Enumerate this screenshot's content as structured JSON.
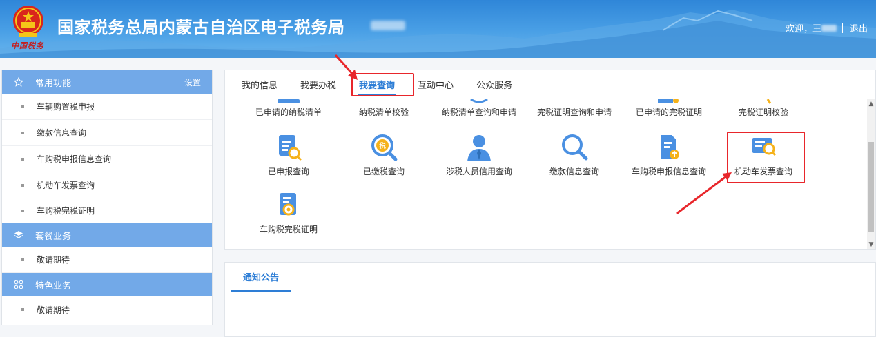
{
  "header": {
    "title": "国家税务总局内蒙古自治区电子税务局",
    "brand_script": "中国税务",
    "welcome": "欢迎，王",
    "logout": "退出"
  },
  "sidebar": {
    "sections": [
      {
        "title": "常用功能",
        "icon": "star-icon",
        "action": "设置",
        "items": [
          "车辆购置税申报",
          "缴款信息查询",
          "车购税申报信息查询",
          "机动车发票查询",
          "车购税完税证明"
        ]
      },
      {
        "title": "套餐业务",
        "icon": "layers-icon",
        "items": [
          "敬请期待"
        ]
      },
      {
        "title": "特色业务",
        "icon": "grid-icon",
        "items": [
          "敬请期待"
        ]
      }
    ]
  },
  "tabs": [
    "我的信息",
    "我要办税",
    "我要查询",
    "互动中心",
    "公众服务"
  ],
  "active_tab": "我要查询",
  "query_items": [
    "已申请的纳税清单",
    "纳税清单校验",
    "纳税清单查询和申请",
    "完税证明查询和申请",
    "已申请的完税证明",
    "完税证明校验",
    "已申报查询",
    "已缴税查询",
    "涉税人员信用查询",
    "缴款信息查询",
    "车购税申报信息查询",
    "机动车发票查询",
    "车购税完税证明"
  ],
  "tax_badge": "税",
  "highlighted_item": "机动车发票查询",
  "notice_tab": "通知公告",
  "colors": {
    "accent": "#2e7ed6",
    "sidebar_head": "#72a9e8",
    "highlight": "#e8262b"
  }
}
